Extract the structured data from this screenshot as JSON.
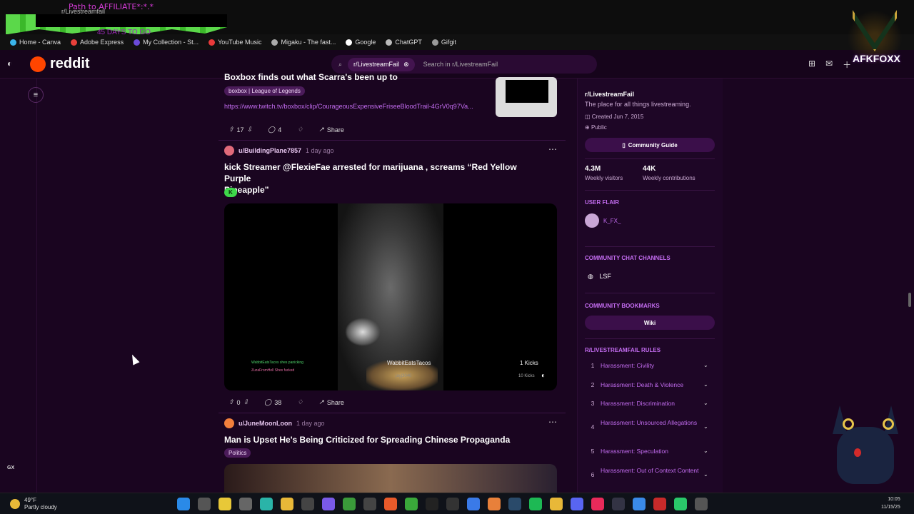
{
  "overlay": {
    "title": "Path to AFFILIATE*:*.*",
    "tab_label": "r/Livestreamfail",
    "counter": "45 DAYS TO GO"
  },
  "bookmarks": [
    {
      "label": "Home - Canva",
      "color": "#3ab4e8"
    },
    {
      "label": "Adobe Express",
      "color": "#e8403a"
    },
    {
      "label": "My Collection - St...",
      "color": "#6a4ad8"
    },
    {
      "label": "YouTube Music",
      "color": "#e83a3a"
    },
    {
      "label": "Migaku - The fast...",
      "color": "#aaaaaa"
    },
    {
      "label": "Google",
      "color": "#ffffff"
    },
    {
      "label": "ChatGPT",
      "color": "#bbbbbb"
    },
    {
      "label": "Gifgit",
      "color": "#9a9a9a"
    }
  ],
  "app": {
    "logo": "reddit",
    "search_chip": "r/LivestreamFail",
    "search_placeholder": "Search in r/LivestreamFail"
  },
  "posts": [
    {
      "title": "Boxbox finds out what Scarra's been up to",
      "flair": "boxbox | League of Legends",
      "link": "https://www.twitch.tv/boxbox/clip/CourageousExpensiveFriseeBloodTrail-4GrV0q97Va...",
      "votes": "17",
      "comments": "4",
      "share": "Share"
    },
    {
      "user": "u/BuildingPlane7857",
      "ago": "1 day ago",
      "title_line1": "kick Streamer @FlexieFae arrested for marijuana , screams “Red Yellow Purple",
      "title_line2": "Pineapple”",
      "flair": "K",
      "video": {
        "streamer": "WabbitEatsTacos",
        "sub": "jayj3040",
        "kicks1": "1 Kicks",
        "kicks2": "10 Kicks",
        "chat1": "WabbitEatsTacos shes panicking",
        "chat2": "ZuzaFromHell Shes fucked"
      },
      "votes": "0",
      "comments": "38",
      "share": "Share"
    },
    {
      "user": "u/JuneMoonLoon",
      "ago": "1 day ago",
      "title": "Man is Upset He's Being Criticized for Spreading Chinese Propaganda",
      "flair": "Politics"
    }
  ],
  "sidebar": {
    "name": "r/LivestreamFail",
    "description": "The place for all things livestreaming.",
    "created": "Created Jun 7, 2015",
    "visibility": "Public",
    "guide_btn": "Community Guide",
    "visitors_num": "4.3M",
    "visitors_label": "Weekly visitors",
    "contrib_num": "44K",
    "contrib_label": "Weekly contributions",
    "user_flair_head": "USER FLAIR",
    "user_flair_name": "K_FX_",
    "chat_head": "COMMUNITY CHAT CHANNELS",
    "chat_channel": "LSF",
    "bookmarks_head": "COMMUNITY BOOKMARKS",
    "wiki_btn": "Wiki",
    "rules_head": "R/LIVESTREAMFAIL RULES",
    "rules": [
      {
        "num": "1",
        "label": "Harassment: Civility"
      },
      {
        "num": "2",
        "label": "Harassment: Death & Violence"
      },
      {
        "num": "3",
        "label": "Harassment: Discrimination"
      },
      {
        "num": "4",
        "label": "Harassment: Unsourced Allegations"
      },
      {
        "num": "5",
        "label": "Harassment: Speculation"
      },
      {
        "num": "6",
        "label": "Harassment: Out of Context Content"
      }
    ]
  },
  "stream_overlay": {
    "name": "AFKFOXX"
  },
  "taskbar": {
    "temp": "49°F",
    "weather": "Partly cloudy",
    "time": "10:05",
    "date": "11/15/25"
  },
  "misc": {
    "gx": "GX"
  }
}
